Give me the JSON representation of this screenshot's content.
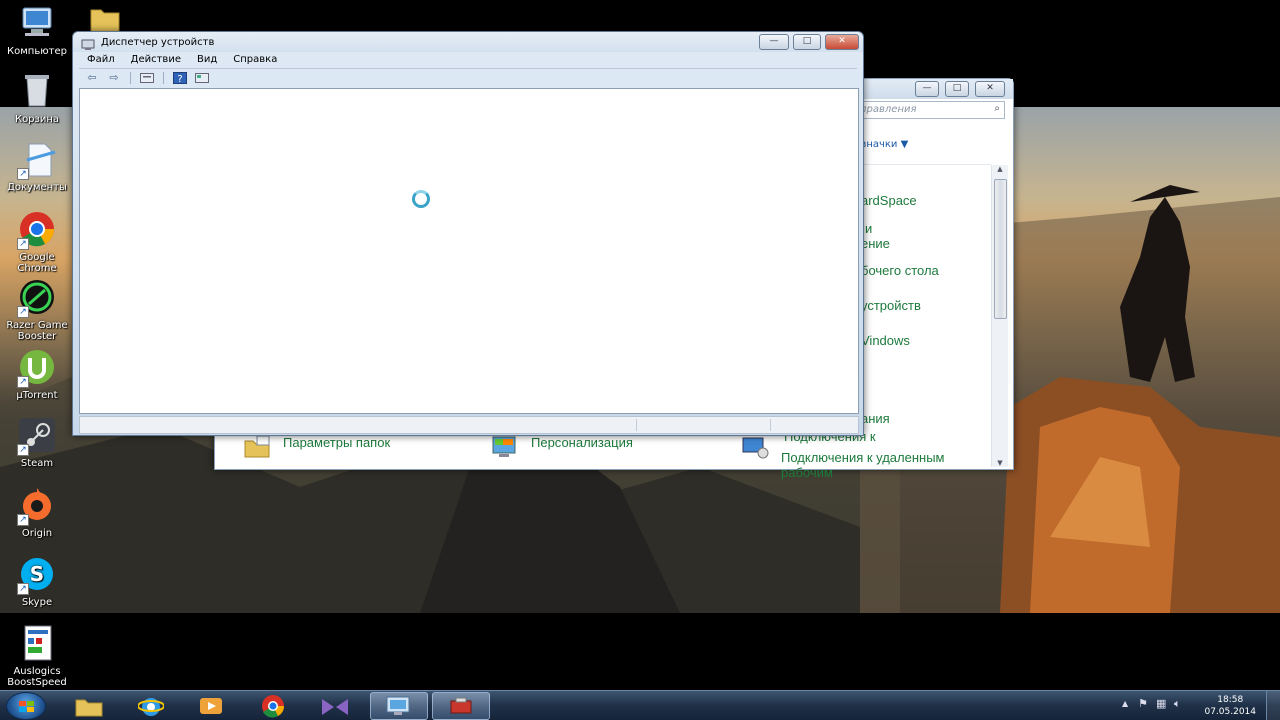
{
  "desktop": {
    "icons": [
      {
        "label": "Компьютер",
        "icon": "computer-icon"
      },
      {
        "label": "",
        "icon": "folder-icon"
      },
      {
        "label": "Корзина",
        "icon": "recycle-bin-icon"
      },
      {
        "label": "Документы",
        "icon": "documents-icon"
      },
      {
        "label": "Google Chrome",
        "icon": "chrome-icon"
      },
      {
        "label": "Razer Game Booster",
        "icon": "razer-icon"
      },
      {
        "label": "µTorrent",
        "icon": "utorrent-icon"
      },
      {
        "label": "Steam",
        "icon": "steam-icon"
      },
      {
        "label": "Origin",
        "icon": "origin-icon"
      },
      {
        "label": "Skype",
        "icon": "skype-icon"
      },
      {
        "label": "Auslogics BoostSpeed",
        "icon": "auslogics-icon"
      }
    ]
  },
  "control_panel": {
    "search_placeholder": "правления",
    "view_label": "значки ▼",
    "items": [
      "ardSpace",
      "и",
      "ение",
      "бочего стола",
      "устройств",
      "Vindows",
      "ания",
      "Подключения к"
    ],
    "bottom_items": [
      {
        "label": "Параметры папок",
        "icon": "folder-options-icon"
      },
      {
        "label": "Персонализация",
        "icon": "personalization-icon"
      },
      {
        "label": "Подключения к удаленным рабочим",
        "icon": "remote-desktop-icon"
      }
    ]
  },
  "device_manager": {
    "title": "Диспетчер устройств",
    "menu": [
      "Файл",
      "Действие",
      "Вид",
      "Справка"
    ],
    "toolbar": [
      "back-arrow-icon",
      "forward-arrow-icon",
      "properties-icon",
      "help-icon",
      "view-icon"
    ]
  },
  "taskbar": {
    "apps": [
      "explorer-icon",
      "ie-icon",
      "media-player-icon",
      "chrome-icon",
      "visual-studio-icon",
      "control-panel-icon",
      "device-manager-icon"
    ],
    "clock_time": "18:58",
    "clock_date": "07.05.2014"
  },
  "colors": {
    "link_green": "#1d7a3c",
    "taskbar": "#1f3148",
    "window_frame": "#c7d8ea"
  }
}
